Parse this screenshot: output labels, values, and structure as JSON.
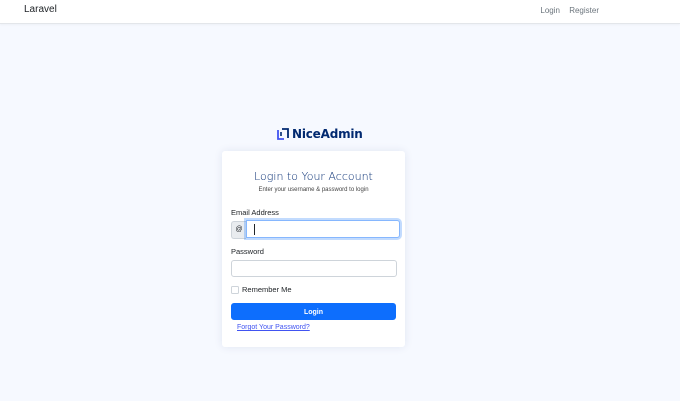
{
  "navbar": {
    "brand": "Laravel",
    "links": [
      "Login",
      "Register"
    ]
  },
  "logo": {
    "icon": "niceadmin-logo-icon",
    "text": "NiceAdmin"
  },
  "card": {
    "title": "Login to Your Account",
    "subtitle": "Enter your username & password to login"
  },
  "form": {
    "email_label": "Email Address",
    "email_addon": "@",
    "email_value": "",
    "password_label": "Password",
    "password_value": "",
    "remember_label": "Remember Me",
    "remember_checked": false,
    "submit_label": "Login",
    "forgot_label": "Forgot Your Password?"
  },
  "colors": {
    "page_bg": "#f6f9ff",
    "primary": "#0d6efd",
    "brand_navy": "#012970",
    "link": "#4154f1"
  }
}
